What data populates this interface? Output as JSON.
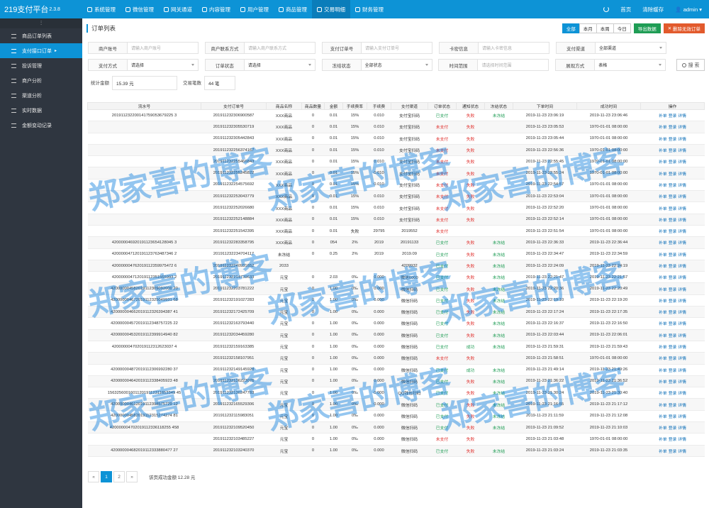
{
  "app": {
    "title": "219支付平台",
    "version": "2.3.8"
  },
  "topnav": [
    {
      "label": "系统管理",
      "icon": "gear-icon"
    },
    {
      "label": "微信管理",
      "icon": "wechat-icon"
    },
    {
      "label": "网关通道",
      "icon": "globe-icon"
    },
    {
      "label": "内容管理",
      "icon": "document-icon"
    },
    {
      "label": "用户管理",
      "icon": "users-icon"
    },
    {
      "label": "商品管理",
      "icon": "shop-icon"
    },
    {
      "label": "交易明细",
      "icon": "chart-icon"
    },
    {
      "label": "财务管理",
      "icon": "finance-icon"
    }
  ],
  "topright": {
    "home": "首页",
    "clear_cache": "清除缓存",
    "user": "admin"
  },
  "sidebar": {
    "toggle": "⫶",
    "items": [
      {
        "label": "商品订单列表"
      },
      {
        "label": "支付接口订单"
      },
      {
        "label": "投诉管理"
      },
      {
        "label": "商户分析"
      },
      {
        "label": "渠道分析"
      },
      {
        "label": "实时数据"
      },
      {
        "label": "金额变动记录"
      }
    ]
  },
  "page": {
    "title": "订单列表"
  },
  "head_buttons": {
    "all": "全部",
    "month": "本月",
    "week": "本周",
    "today": "今日",
    "export": "导出数据",
    "delete_invalid": "删除无效订单"
  },
  "filters": {
    "merchant_no": {
      "label": "商户账号",
      "placeholder": "请输入商户账号"
    },
    "merchant_contact": {
      "label": "商户联系方式",
      "placeholder": "请输入商户联系方式"
    },
    "pay_order_no": {
      "label": "支付订单号",
      "placeholder": "请输入支付订单号"
    },
    "card_info": {
      "label": "卡密信息",
      "placeholder": "请输入卡密信息"
    },
    "pay_channel": {
      "label": "支付渠道",
      "value": "全部渠道"
    },
    "pay_method": {
      "label": "支付方式",
      "value": "请选择"
    },
    "order_status": {
      "label": "订单状态",
      "value": "请选择"
    },
    "freeze_status": {
      "label": "冻结状态",
      "value": "全部状态"
    },
    "time_range": {
      "label": "时间范围",
      "placeholder": "请选择时间范围"
    },
    "display_mode": {
      "label": "展现方式",
      "value": "表格"
    },
    "search_label": "搜 索"
  },
  "stats": {
    "total_label": "统计金额",
    "total_value": "15.39 元",
    "count_label": "交易笔数",
    "count_value": "44 笔"
  },
  "table": {
    "headers": [
      "流水号",
      "支付订单号",
      "商品名称",
      "商品数量",
      "金额",
      "手续费率",
      "手续费",
      "支付渠道",
      "订单状态",
      "通知状态",
      "冻结状态",
      "下单时间",
      "成功时间",
      "操作"
    ],
    "ops": [
      "补单",
      "登录",
      "详情"
    ],
    "rows": [
      [
        "201911232200141759053679225 3",
        "201911232306900587",
        "XXX商品",
        "0",
        "0.01",
        "15%",
        "0.010",
        "支付宝扫码",
        "已支付",
        "失败",
        "未冻结",
        "2019-11-23 23:06:19",
        "2019-11-23 23:06:46"
      ],
      [
        "",
        "201911232305530719",
        "XXX商品",
        "0",
        "0.01",
        "15%",
        "0.010",
        "支付宝扫码",
        "未支付",
        "失败",
        "",
        "2019-11-23 23:05:53",
        "1970-01-01 08:00:00"
      ],
      [
        "",
        "201911232305442843",
        "XXX商品",
        "0",
        "0.01",
        "15%",
        "0.010",
        "支付宝扫码",
        "未支付",
        "失败",
        "",
        "2019-11-23 23:05:44",
        "1970-01-01 08:00:00"
      ],
      [
        "",
        "201911232256374167",
        "XXX商品",
        "0",
        "0.01",
        "15%",
        "0.010",
        "支付宝扫码",
        "未支付",
        "失败",
        "",
        "2019-11-23 22:56:36",
        "1970-01-01 08:00:00"
      ],
      [
        "",
        "201911232255466843",
        "XXX商品",
        "0",
        "0.01",
        "15%",
        "0.010",
        "支付宝扫码",
        "未支付",
        "失败",
        "",
        "2019-11-23 22:55:45",
        "1970-01-01 08:00:00"
      ],
      [
        "",
        "201911232255245822",
        "XXX商品",
        "0",
        "0.01",
        "15%",
        "0.010",
        "支付宝扫码",
        "未支付",
        "失败",
        "",
        "2019-11-23 22:55:24",
        "1970-01-01 08:00:00"
      ],
      [
        "",
        "201911232254575692",
        "XXX商品",
        "0",
        "0.01",
        "15%",
        "0.010",
        "支付宝扫码",
        "未支付",
        "失败",
        "",
        "2019-11-23 22:54:57",
        "1970-01-01 08:00:00"
      ],
      [
        "",
        "201911232253043779",
        "XXX商品",
        "0",
        "0.01",
        "15%",
        "0.010",
        "支付宝扫码",
        "未支付",
        "失败",
        "",
        "2019-11-23 22:53:04",
        "1970-01-01 08:00:00"
      ],
      [
        "",
        "201911232252026680",
        "XXX商品",
        "0",
        "0.01",
        "15%",
        "0.010",
        "支付宝扫码",
        "未支付",
        "失败",
        "",
        "2019-11-23 22:52:20",
        "1970-01-01 08:00:00"
      ],
      [
        "",
        "201911232252148884",
        "XXX商品",
        "0",
        "0.01",
        "15%",
        "0.010",
        "支付宝扫码",
        "未支付",
        "失败",
        "",
        "2019-11-23 22:52:14",
        "1970-01-01 08:00:00"
      ],
      [
        "",
        "201911232251542395",
        "XXX商品",
        "0",
        "0.01",
        "失败",
        "29795",
        "2019552",
        "未支付",
        "",
        "",
        "2019-11-23 22:51:54",
        "1970-01-01 08:00:00"
      ],
      [
        "420000046920191123654128045 3",
        "201911232283358795",
        "XXX商品",
        "0",
        "054",
        "2%",
        "2019",
        "20191133",
        "已支付",
        "失败",
        "未冻结",
        "2019-11-23 22:36:33",
        "2019-11-23 22:36:44"
      ],
      [
        "420000047120191123763487346 2",
        "201911232234704117",
        "未冻结",
        "0",
        "0.25",
        "2%",
        "2019",
        "2019.09",
        "已支付",
        "失败",
        "未冻结",
        "2019-11-23 22:34:47",
        "2019-11-23 22:34:59"
      ],
      [
        "420000004762019112359975472 6",
        "201911232240931652",
        "2033",
        "",
        "",
        "",
        "",
        "4209932",
        "已支付",
        "失败",
        "未冻结",
        "2019-11-23 22:24:09",
        "2019-11-23 22:24:19"
      ],
      [
        "420000004712019112351565993 2",
        "201911232214739633",
        "元宝",
        "0",
        "2.03",
        "0‰",
        "0.000",
        "微信6000",
        "已支付",
        "失败",
        "未冻结",
        "2019-11-23 22:21:47",
        "2019-11-23 22:21:57"
      ],
      [
        "420000004582019112309092000 20",
        "201911232203781222",
        "元宝",
        "0",
        "1.00",
        "0‰",
        "0.000",
        "微信扫码",
        "已支付",
        "失败",
        "未冻结",
        "2019-11-23 22:20:36",
        "2019-11-23 22:20:49"
      ],
      [
        "420000004672019112325049931 68",
        "201911232191027283",
        "元宝",
        "0",
        "1.00",
        "0‰",
        "0.000",
        "微信扫码",
        "已支付",
        "失败",
        "未冻结",
        "2019-11-23 22:19:10",
        "2019-11-23 22:19:20"
      ],
      [
        "420000004662019112326394387 41",
        "201911232172425709",
        "元宝",
        "0",
        "1.00",
        "0‰",
        "0.000",
        "微信扫码",
        "已支付",
        "失败",
        "未冻结",
        "2019-11-23 22:17:24",
        "2019-11-23 22:17:35"
      ],
      [
        "420000004572019112348757225 22",
        "201911232163793440",
        "元宝",
        "0",
        "1.00",
        "0‰",
        "0.000",
        "微信扫码",
        "已支付",
        "失败",
        "未冻结",
        "2019-11-23 22:16:37",
        "2019-11-23 22:16:50"
      ],
      [
        "420000004532019112399914940 82",
        "201911232034459280",
        "元宝",
        "0",
        "1.00",
        "0‰",
        "0.000",
        "微信扫码",
        "已支付",
        "失败",
        "未冻结",
        "2019-11-23 22:03:44",
        "2019-11-23 22:06:01"
      ],
      [
        "420000004702019112312623037 4",
        "201911232159163385",
        "元宝",
        "0",
        "1.00",
        "0‰",
        "0.000",
        "微信扫码",
        "已支付",
        "成功",
        "未冻结",
        "2019-11-23 21:59:31",
        "2019-11-23 21:59:43"
      ],
      [
        "",
        "201911232158107951",
        "元宝",
        "0",
        "1.00",
        "0‰",
        "0.000",
        "微信扫码",
        "未支付",
        "失败",
        "",
        "2019-11-23 21:58:51",
        "1970-01-01 08:00:00"
      ],
      [
        "420000004872019112306992280 37",
        "201911232149145928",
        "元宝",
        "0",
        "1.00",
        "0‰",
        "0.000",
        "微信扫码",
        "已支付",
        "成功",
        "未冻结",
        "2019-11-23 21:49:14",
        "2019-11-23 21:49:26"
      ],
      [
        "420000004642019112338405923 48",
        "201911232136223076",
        "元宝",
        "0",
        "1.00",
        "0‰",
        "0.000",
        "微信扫码",
        "已支付",
        "失败",
        "未冻结",
        "2019-11-23 21:36:22",
        "2019-11-23 21:36:52"
      ],
      [
        "156325600160112019112311653349 45",
        "201911232130247783",
        "元宝",
        "0",
        "1.00",
        "0‰",
        "0.000",
        "QQ钱包扫码",
        "已支付",
        "失败",
        "未冻结",
        "2019-11-23 21:30:24",
        "2019-11-23 21:30:40"
      ],
      [
        "420000004612019112398575729 12",
        "201911232165529306",
        "元宝",
        "0",
        "1.00",
        "0‰",
        "0.000",
        "微信扫码",
        "已支付",
        "失败",
        "未冻结",
        "2019-11-23 21:16:55",
        "2019-11-23 21:17:12"
      ],
      [
        "420000004582019112315274274 81",
        "201911232115983051",
        "元宝",
        "0",
        "1.00",
        "0‰",
        "0.000",
        "微信扫码",
        "已支付",
        "失败",
        "未冻结",
        "2019-11-23 21:11:59",
        "2019-11-23 21:12:08"
      ],
      [
        "420000004702019112336118255 458",
        "201911232109520450",
        "元宝",
        "0",
        "1.00",
        "0‰",
        "0.000",
        "微信扫码",
        "已支付",
        "失败",
        "未冻结",
        "2019-11-23 21:09:52",
        "2019-11-23 21:10:03"
      ],
      [
        "",
        "201911232103485227",
        "元宝",
        "0",
        "1.00",
        "0‰",
        "0.000",
        "微信扫码",
        "未支付",
        "失败",
        "",
        "2019-11-23 21:03:48",
        "1970-01-01 08:00:00"
      ],
      [
        "420000004682019112333880477 27",
        "201911232103240370",
        "元宝",
        "0",
        "1.00",
        "0‰",
        "0.000",
        "微信扫码",
        "已支付",
        "失败",
        "未冻结",
        "2019-11-23 21:03:24",
        "2019-11-23 21:03:35"
      ]
    ]
  },
  "pagination": {
    "prev": "«",
    "pages": [
      "1",
      "2"
    ],
    "next": "»",
    "info": "该页成功金额 12.28 元"
  },
  "watermark": {
    "text": "郑家喜的博客"
  },
  "colors": {
    "accent": "#0d93d6",
    "sidebar": "#2f3640",
    "red": "#e0302d",
    "green": "#1f9d55",
    "export": "#1f9d55",
    "delete": "#e25a2c"
  }
}
